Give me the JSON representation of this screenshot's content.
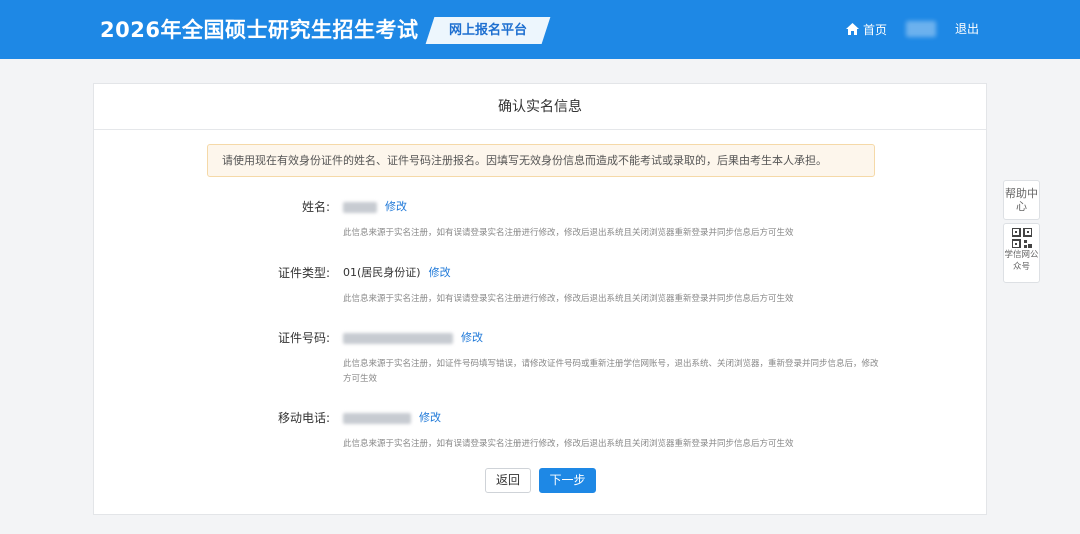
{
  "header": {
    "title": "2026年全国硕士研究生招生考试",
    "platform": "网上报名平台",
    "home_label": "首页",
    "logout_label": "退出"
  },
  "page": {
    "heading": "确认实名信息",
    "notice": "请使用现在有效身份证件的姓名、证件号码注册报名。因填写无效身份信息而造成不能考试或录取的，后果由考生本人承担。"
  },
  "fields": [
    {
      "label": "姓名:",
      "edit": "修改",
      "note": "此信息来源于实名注册，如有误请登录实名注册进行修改，修改后退出系统且关闭浏览器重新登录并同步信息后方可生效"
    },
    {
      "label": "证件类型:",
      "value": "01(居民身份证)",
      "edit": "修改",
      "note": "此信息来源于实名注册，如有误请登录实名注册进行修改，修改后退出系统且关闭浏览器重新登录并同步信息后方可生效"
    },
    {
      "label": "证件号码:",
      "edit": "修改",
      "note": "此信息来源于实名注册，如证件号码填写错误，请修改证件号码或重新注册学信网账号，退出系统、关闭浏览器，重新登录并同步信息后，修改方可生效"
    },
    {
      "label": "移动电话:",
      "edit": "修改",
      "note": "此信息来源于实名注册，如有误请登录实名注册进行修改，修改后退出系统且关闭浏览器重新登录并同步信息后方可生效"
    }
  ],
  "buttons": {
    "back": "返回",
    "next": "下一步"
  },
  "side": {
    "help": "帮助中心",
    "qr": "学信网公众号"
  },
  "colors": {
    "primary": "#1e88e5",
    "link": "#1e78d8",
    "notice_bg": "#fdf6ec",
    "notice_border": "#f5d9a8"
  }
}
